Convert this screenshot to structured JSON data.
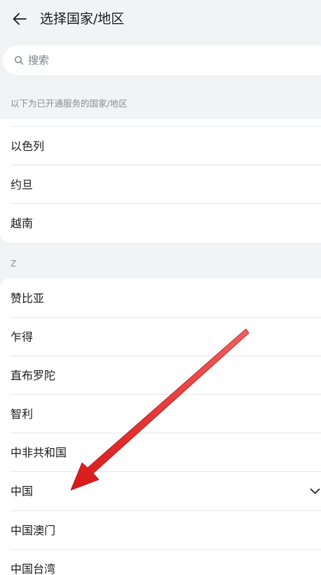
{
  "header": {
    "title": "选择国家/地区"
  },
  "search": {
    "placeholder": "搜索"
  },
  "sections": {
    "available_label": "以下为已开通服务的国家/地区",
    "z_letter": "Z"
  },
  "list_top": {
    "items": [
      "以色列",
      "约旦",
      "越南"
    ]
  },
  "list_z": {
    "items": [
      "赞比亚",
      "乍得",
      "直布罗陀",
      "智利",
      "中非共和国",
      "中国",
      "中国澳门",
      "中国台湾"
    ]
  },
  "icons": {
    "back": "arrow-left-icon",
    "search": "search-icon",
    "expand": "chevron-down-icon",
    "annotation": "red-arrow-annotation"
  },
  "colors": {
    "background": "#f1f3f5",
    "card": "#ffffff",
    "text": "#1a1a1a",
    "muted": "#8a8d92",
    "arrow": "#e02020"
  }
}
